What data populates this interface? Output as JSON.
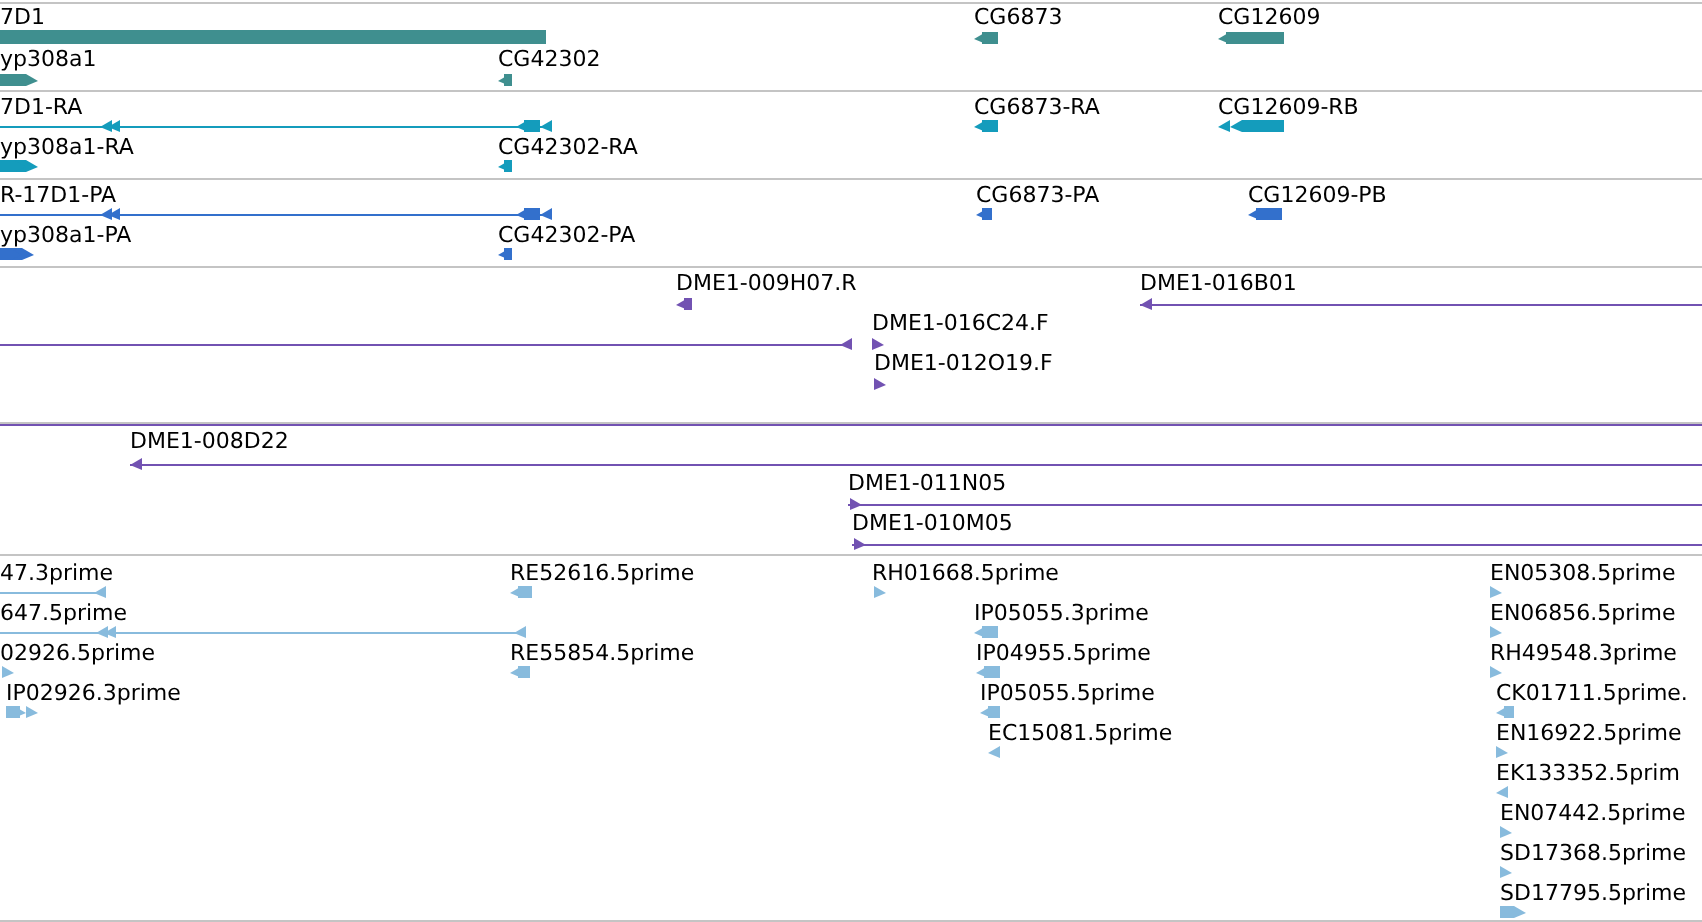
{
  "tracks": [
    {
      "color": "#3f8f8f",
      "features": [
        {
          "label": "7D1"
        },
        {
          "label": "yp308a1",
          "reverse": false
        },
        {
          "label": "CG42302",
          "reverse": true
        },
        {
          "label": "CG6873",
          "reverse": true
        },
        {
          "label": "CG12609",
          "reverse": true
        }
      ]
    },
    {
      "color": "#149cbc",
      "features": [
        {
          "label": "7D1-RA",
          "reverse": true
        },
        {
          "label": "yp308a1-RA",
          "reverse": false
        },
        {
          "label": "CG42302-RA",
          "reverse": true
        },
        {
          "label": "CG6873-RA",
          "reverse": true
        },
        {
          "label": "CG12609-RB",
          "reverse": true
        }
      ]
    },
    {
      "color": "#3370cc",
      "features": [
        {
          "label": "R-17D1-PA",
          "reverse": true
        },
        {
          "label": "yp308a1-PA",
          "reverse": false
        },
        {
          "label": "CG42302-PA",
          "reverse": true
        },
        {
          "label": "CG6873-PA",
          "reverse": true
        },
        {
          "label": "CG12609-PB",
          "reverse": true
        }
      ]
    },
    {
      "color": "#7252b2",
      "features": [
        {
          "label": "DME1-009H07.R",
          "reverse": true
        },
        {
          "label": "DME1-016B01",
          "reverse": true
        },
        {
          "reverse": true
        },
        {
          "label": "DME1-016C24.F",
          "reverse": false
        },
        {
          "label": "DME1-012O19.F",
          "reverse": false
        }
      ]
    },
    {
      "color": "#7252b2",
      "features": [
        {
          "label": "DME1-008D22",
          "reverse": true
        },
        {
          "label": "DME1-011N05",
          "reverse": false
        },
        {
          "label": "DME1-010M05",
          "reverse": false
        }
      ]
    },
    {
      "color": "#88bbdd",
      "features": [
        {
          "label": "47.3prime",
          "reverse": true
        },
        {
          "label": "647.5prime",
          "reverse": true
        },
        {
          "label": "02926.5prime",
          "reverse": false
        },
        {
          "label": "IP02926.3prime",
          "reverse": false
        },
        {
          "label": "RE52616.5prime",
          "reverse": true
        },
        {
          "label": "RE55854.5prime",
          "reverse": true
        },
        {
          "label": "RH01668.5prime",
          "reverse": false
        },
        {
          "label": "IP05055.3prime",
          "reverse": true
        },
        {
          "label": "IP04955.5prime",
          "reverse": true
        },
        {
          "label": "IP05055.5prime",
          "reverse": true
        },
        {
          "label": "EC15081.5prime",
          "reverse": true
        },
        {
          "label": "EN05308.5prime",
          "reverse": false
        },
        {
          "label": "EN06856.5prime",
          "reverse": false
        },
        {
          "label": "RH49548.3prime",
          "reverse": false
        },
        {
          "label": "CK01711.5prime.",
          "reverse": true
        },
        {
          "label": "EN16922.5prime",
          "reverse": false
        },
        {
          "label": "EK133352.5prim",
          "reverse": true
        },
        {
          "label": "EN07442.5prime",
          "reverse": false
        },
        {
          "label": "SD17368.5prime",
          "reverse": false
        },
        {
          "label": "SD17795.5prime",
          "reverse": false
        }
      ]
    }
  ]
}
